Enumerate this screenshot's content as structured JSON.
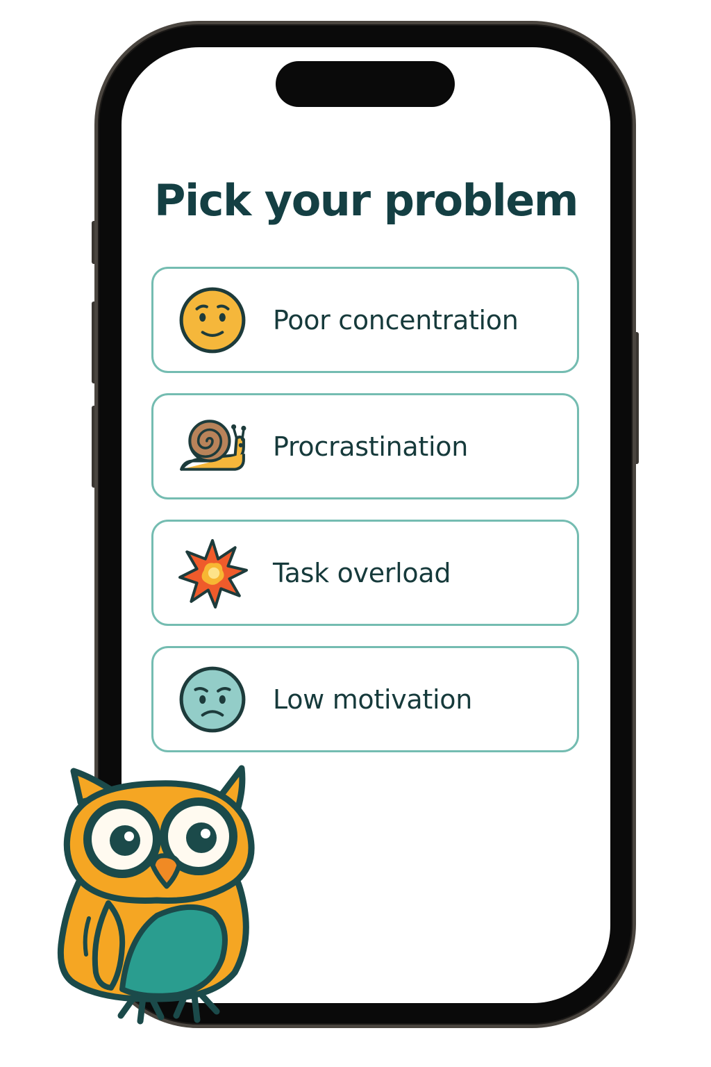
{
  "screen": {
    "title": "Pick your problem"
  },
  "options": [
    {
      "label": "Poor concentration",
      "icon": "worried-face-icon"
    },
    {
      "label": "Procrastination",
      "icon": "snail-icon"
    },
    {
      "label": "Task overload",
      "icon": "explosion-icon"
    },
    {
      "label": "Low motivation",
      "icon": "sad-face-icon"
    }
  ],
  "colors": {
    "title": "#143f43",
    "card_border": "#74bcb1",
    "owl_body": "#f5a623",
    "owl_belly": "#2a9d8f",
    "outline": "#1b4a4a"
  }
}
